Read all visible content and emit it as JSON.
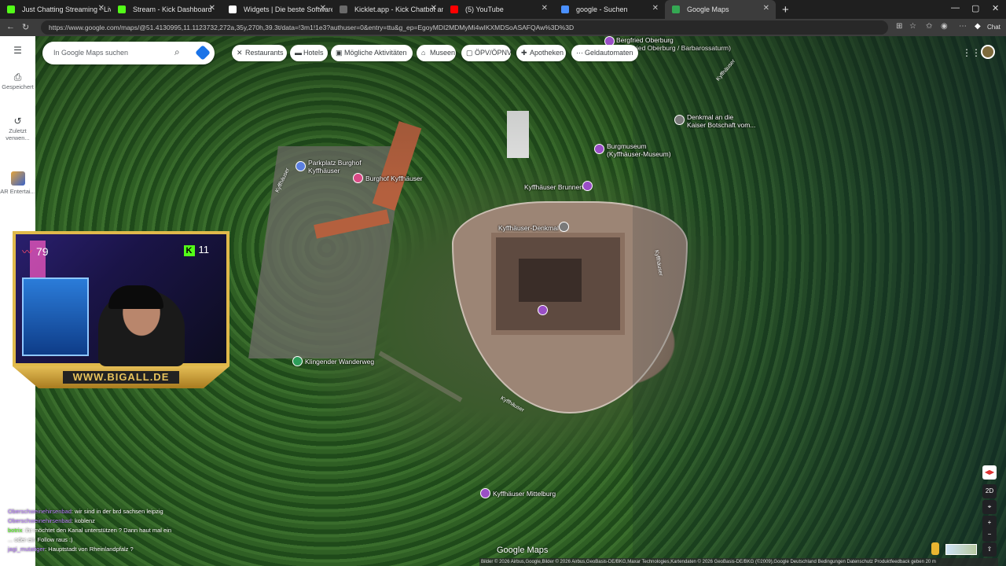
{
  "tabs": [
    {
      "title": "Just Chatting Streaming - Live Stre",
      "color": "#53fc18"
    },
    {
      "title": "Stream - Kick Dashboard",
      "color": "#53fc18"
    },
    {
      "title": "Widgets | Die beste Software zur",
      "color": "#ffffff"
    },
    {
      "title": "Kicklet.app - Kick Chatbot and Ov",
      "color": "#3d3d3d"
    },
    {
      "title": "(5) YouTube",
      "color": "#ff0000"
    },
    {
      "title": "google - Suchen",
      "color": "#4a90ff"
    },
    {
      "title": "Google Maps",
      "color": "#34a853"
    }
  ],
  "address": {
    "url": "https://www.google.com/maps/@51.4130995,11.1123732,272a,35y,270h,39.3t/data=!3m1!1e3?authuser=0&entry=ttu&g_ep=EgoyMDI2MDMyMi4wIKXMDSoASAFQAw%3D%3D",
    "chat_label": "Chat"
  },
  "sidebar": {
    "menu_icon": "menu-icon",
    "items": [
      {
        "label": "Gespeichert",
        "icon": "bookmark-icon"
      },
      {
        "label": "Zuletzt verwen...",
        "icon": "history-icon"
      },
      {
        "label": "AR Entertai...",
        "icon": "app-icon"
      }
    ]
  },
  "search": {
    "placeholder": "In Google Maps suchen"
  },
  "chips": [
    {
      "label": "Restaurants",
      "icon": "fork-icon"
    },
    {
      "label": "Hotels",
      "icon": "bed-icon"
    },
    {
      "label": "Mögliche Aktivitäten",
      "icon": "camera-icon"
    },
    {
      "label": "Museen",
      "icon": "museum-icon"
    },
    {
      "label": "ÖPV/ÖPNV",
      "icon": "transit-icon"
    },
    {
      "label": "Apotheken",
      "icon": "pharmacy-icon"
    },
    {
      "label": "Geldautomaten",
      "icon": "atm-icon"
    }
  ],
  "places": [
    {
      "name": "Bergfried Oberburg",
      "sub": "(Bergfried Oberburg / Barbarossaturm)",
      "type": "purple"
    },
    {
      "name": "Denkmal an die",
      "sub": "Kaiser Botschaft vom...",
      "type": "gray"
    },
    {
      "name": "Burgmuseum",
      "sub": "(Kyffhäuser-Museum)",
      "type": "purple"
    },
    {
      "name": "Parkplatz Burghof",
      "sub": "Kyffhäuser",
      "type": "blue"
    },
    {
      "name": "Burghof Kyffhäuser",
      "sub": "",
      "type": "pink"
    },
    {
      "name": "Kyffhäuser Brunnen",
      "sub": "",
      "type": "purple"
    },
    {
      "name": "Kyffhäuser-Denkmal",
      "sub": "",
      "type": "gray"
    },
    {
      "name": "Klingender Wanderweg",
      "sub": "",
      "type": "green"
    },
    {
      "name": "Kyffhäuser Mittelburg",
      "sub": "",
      "type": "purple"
    }
  ],
  "roads": [
    {
      "name": "Kyffhäuser"
    },
    {
      "name": "Kyffhäuser"
    },
    {
      "name": "Kyffhäuser"
    },
    {
      "name": "Kyffhäuser"
    }
  ],
  "overlay": {
    "heart_rate": "79",
    "kick_count": "11",
    "banner": "WWW.BIGALL.DE"
  },
  "chat": [
    {
      "user": "Oberschweinehirsenbad",
      "text": ": wir sind in der brd sachsen leipzig"
    },
    {
      "user": "Oberschweinehirsenbad",
      "text": ": koblenz"
    },
    {
      "user": "botrix",
      "text": ": ihr möchtet den Kanal unterstützen ? Dann haut mal ein"
    },
    {
      "user": "",
      "text": "... oder ein Follow raus :)"
    },
    {
      "user": "jagi_mutatiger",
      "text": ": Hauptstadt von Rheinlandpfalz ?"
    }
  ],
  "map": {
    "logo": "Google Maps",
    "attribution": "Bilder © 2026 Airbus,Google,Bilder © 2026 Airbus,GeoBasis-DE/BKG,Maxar Technologies,Kartendaten © 2026 GeoBasis-DE/BKG (©2009),Google   Deutschland   Bedingungen   Datenschutz   Produktfeedback geben   20 m",
    "controls": [
      "2D",
      "⌖",
      "+",
      "−",
      "⇧"
    ]
  }
}
